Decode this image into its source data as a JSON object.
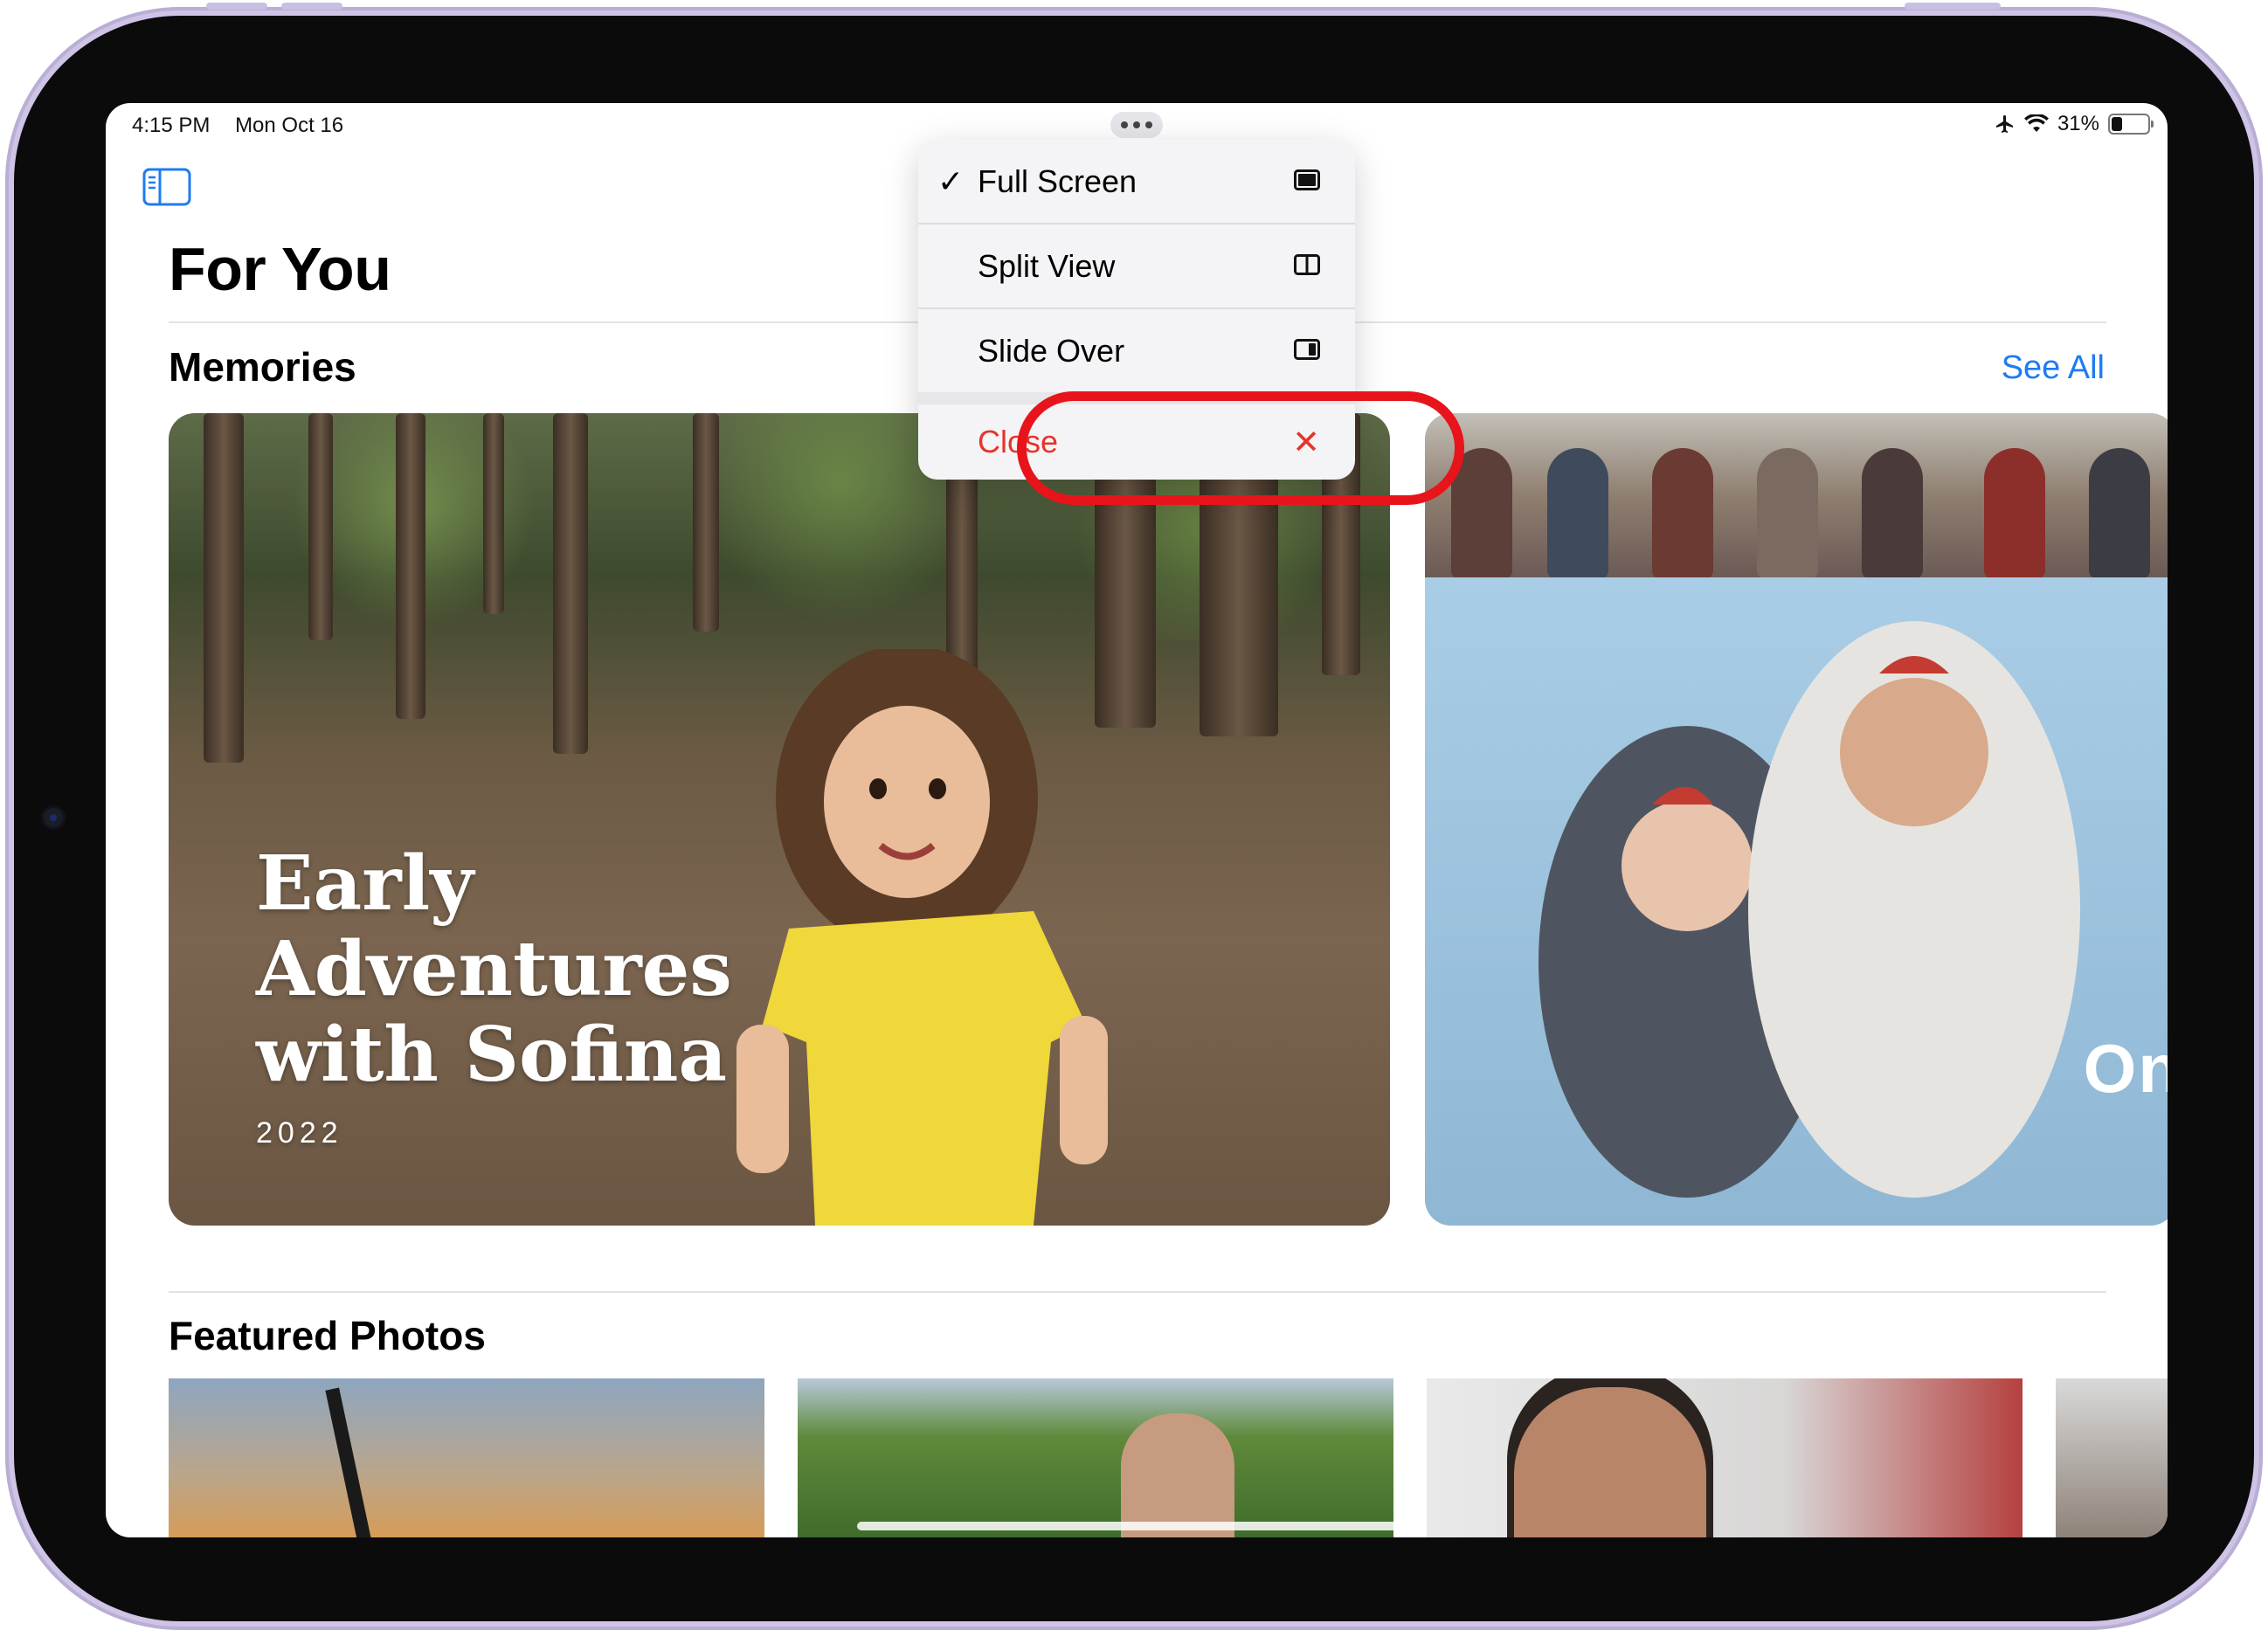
{
  "status_bar": {
    "time": "4:15 PM",
    "date": "Mon Oct 16",
    "battery_percent": "31%",
    "battery_level": 0.31
  },
  "header": {
    "title": "For You"
  },
  "memories": {
    "section_title": "Memories",
    "see_all_label": "See All",
    "cards": [
      {
        "title_lines": [
          "Early",
          "Adventures",
          "with Sofina"
        ],
        "year": "2022"
      },
      {
        "title_partial": "On"
      }
    ]
  },
  "featured": {
    "section_title": "Featured Photos"
  },
  "multitasking_menu": {
    "items": [
      {
        "label": "Full Screen",
        "checked": true,
        "icon": "full-screen-icon"
      },
      {
        "label": "Split View",
        "checked": false,
        "icon": "split-view-icon"
      },
      {
        "label": "Slide Over",
        "checked": false,
        "icon": "slide-over-icon",
        "highlighted": true
      },
      {
        "label": "Close",
        "destructive": true,
        "icon": "close-x-icon"
      }
    ],
    "check_glyph": "✓",
    "close_glyph": "✕"
  },
  "colors": {
    "accent_blue": "#1f7bf2",
    "destructive_red": "#e5342b",
    "highlight_ring": "#e8141b"
  }
}
